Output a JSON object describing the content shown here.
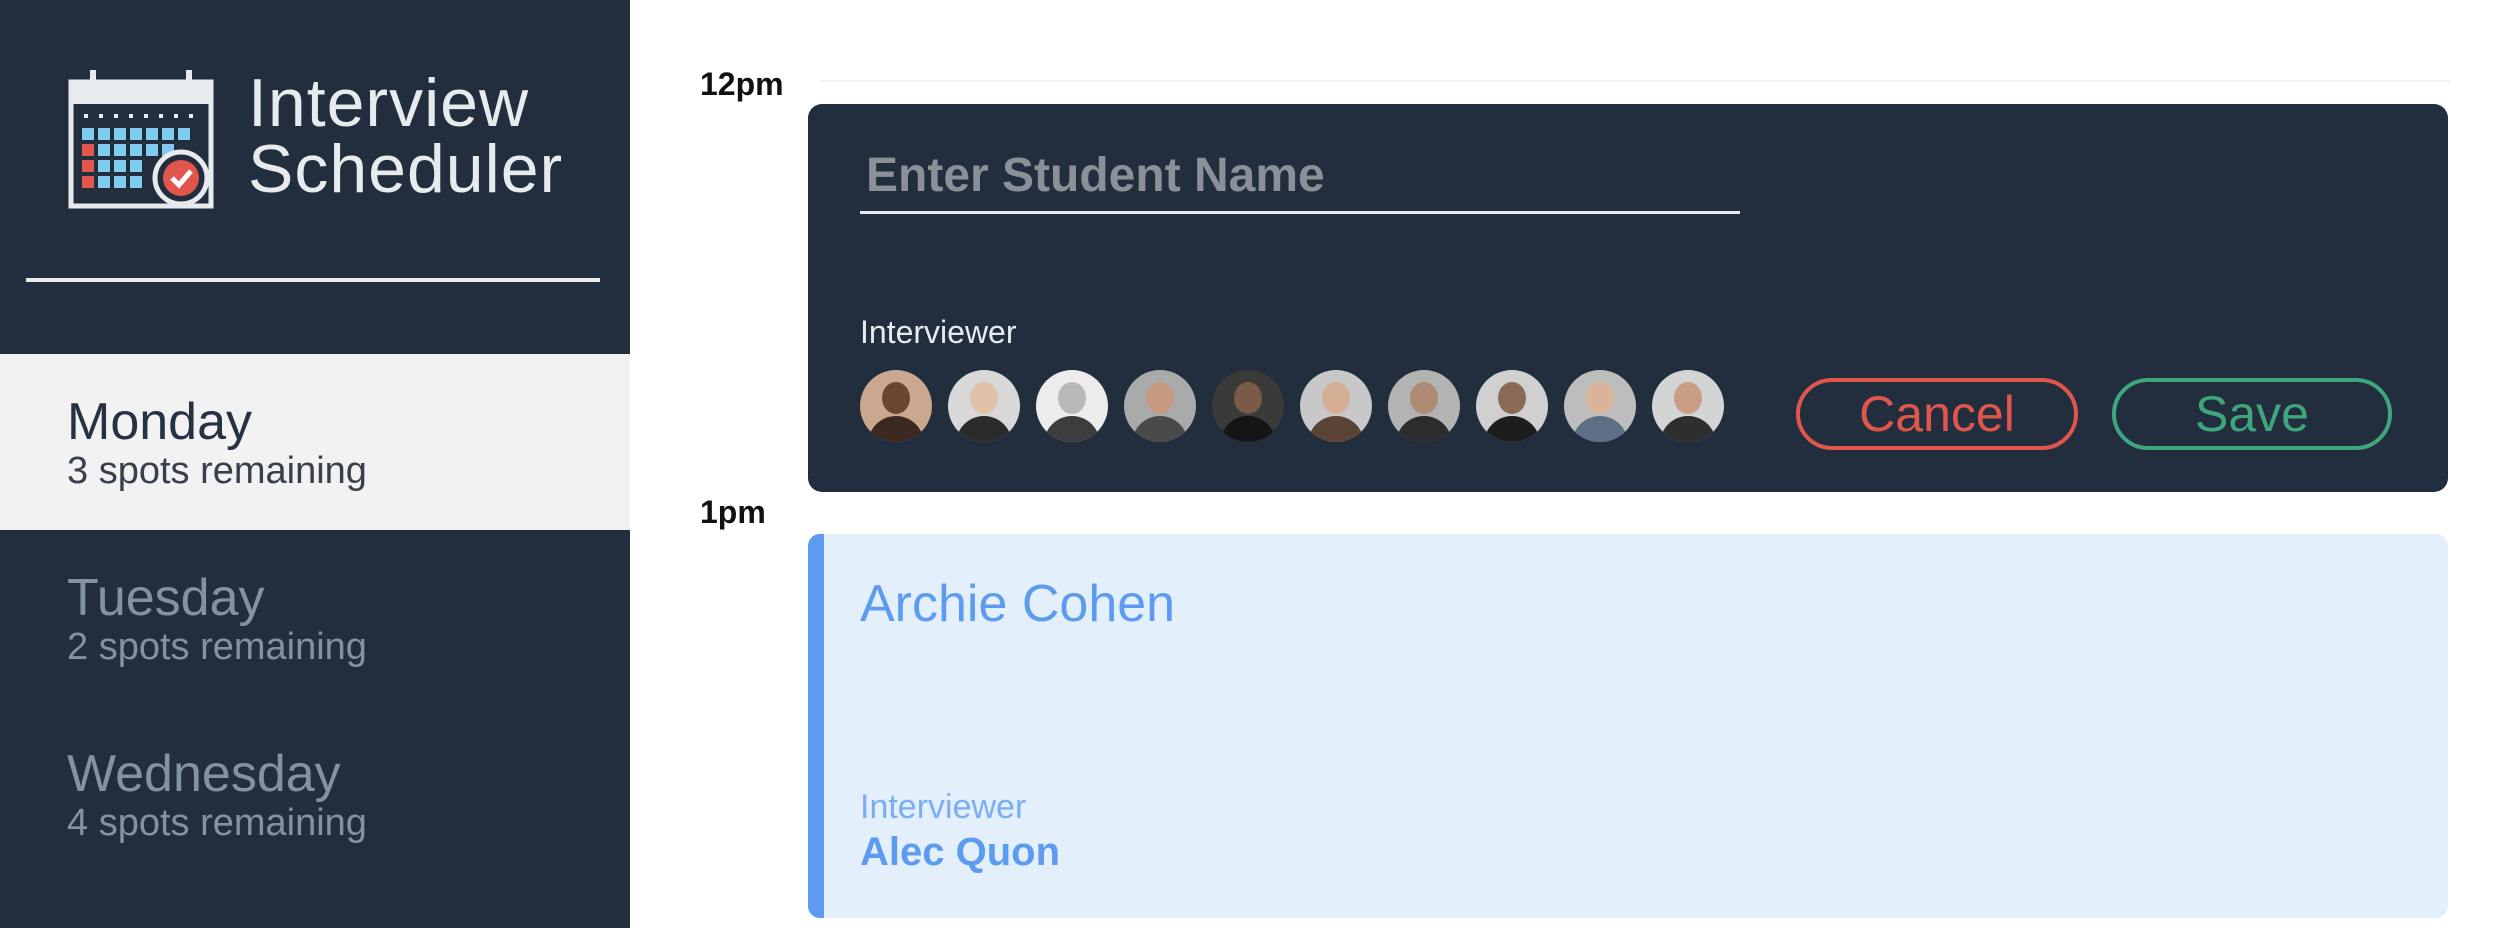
{
  "app": {
    "title_line1": "Interview",
    "title_line2": "Scheduler",
    "logo_icon": "calendar-check-icon"
  },
  "days": [
    {
      "name": "Monday",
      "spots": "3 spots remaining",
      "selected": true
    },
    {
      "name": "Tuesday",
      "spots": "2 spots remaining",
      "selected": false
    },
    {
      "name": "Wednesday",
      "spots": "4 spots remaining",
      "selected": false
    }
  ],
  "schedule": {
    "times": [
      "12pm",
      "1pm"
    ],
    "form": {
      "student_placeholder": "Enter Student Name",
      "student_value": "",
      "interviewer_label": "Interviewer",
      "interviewers_count": 10,
      "cancel_label": "Cancel",
      "save_label": "Save"
    },
    "appointment": {
      "student": "Archie Cohen",
      "interviewer_label": "Interviewer",
      "interviewer_name": "Alec Quon"
    }
  },
  "colors": {
    "sidebar_bg": "#222e3d",
    "selected_day_bg": "#f2f2f2",
    "cancel": "#e0564d",
    "save": "#3fa57d",
    "appointment_accent": "#5c9bf0",
    "appointment_bg": "#e4effc"
  }
}
